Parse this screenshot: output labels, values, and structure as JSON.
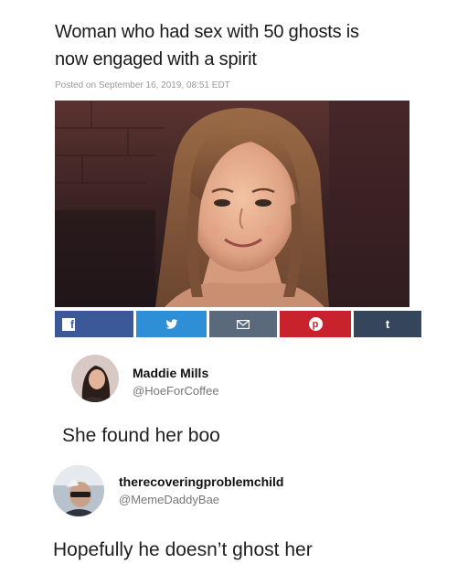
{
  "article": {
    "headline_line1": "Woman who had sex with 50 ghosts is",
    "headline_line2": "now engaged with a spirit",
    "posted": "Posted on September 16, 2019, 08:51 EDT"
  },
  "share_bar": {
    "buttons": [
      {
        "name": "facebook",
        "label": "f",
        "color": "#3b5998"
      },
      {
        "name": "twitter",
        "label": "twitter-bird",
        "color": "#2f8fd6"
      },
      {
        "name": "email",
        "label": "envelope",
        "color": "#5a6a7c"
      },
      {
        "name": "pinterest",
        "label": "p",
        "color": "#c8232c"
      },
      {
        "name": "tumblr",
        "label": "t",
        "color": "#35465c"
      }
    ]
  },
  "tweets": [
    {
      "name": "Maddie Mills",
      "handle": "@HoeForCoffee",
      "text": "She found her boo"
    },
    {
      "name": "therecoveringproblemchild",
      "handle": "@MemeDaddyBae",
      "text": "Hopefully he doesn’t ghost her"
    }
  ]
}
